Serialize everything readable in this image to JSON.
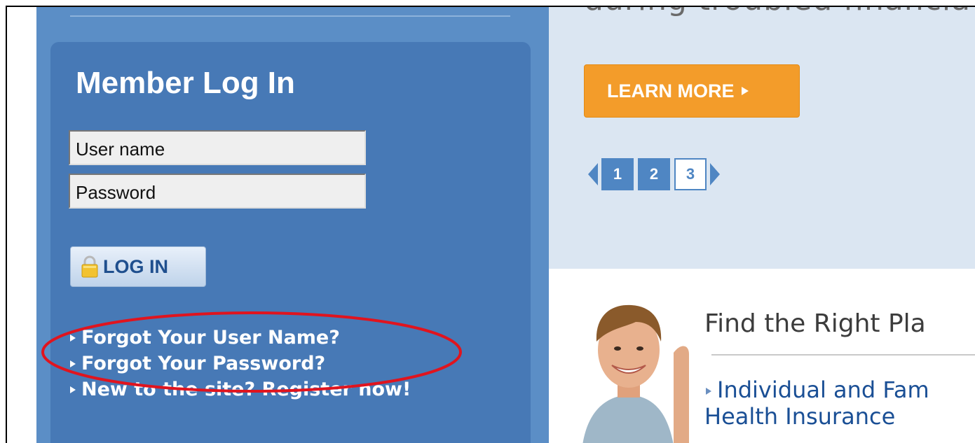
{
  "login": {
    "title": "Member Log In",
    "username_value": "User name",
    "password_value": "Password",
    "login_button": "LOG IN",
    "links": [
      "Forgot Your User Name?",
      "Forgot Your Password?",
      "New to the site? Register now!"
    ]
  },
  "banner": {
    "partial_text": "during troubled financia",
    "learn_more": "LEARN MORE",
    "pages": [
      "1",
      "2",
      "3"
    ],
    "current_page": "3"
  },
  "find": {
    "title": "Find the Right Pla",
    "link_line1": "Individual and Fam",
    "link_line2": "Health Insurance"
  },
  "colors": {
    "sidebar": "#5b8ec6",
    "panel": "#4779b6",
    "banner": "#dbe6f2",
    "learn_button": "#f39c2a",
    "annotation": "#e0141e"
  },
  "icons": [
    "lock-icon",
    "bullet-icon",
    "arrow-right-icon",
    "arrow-left-icon",
    "arrow-right-icon"
  ]
}
